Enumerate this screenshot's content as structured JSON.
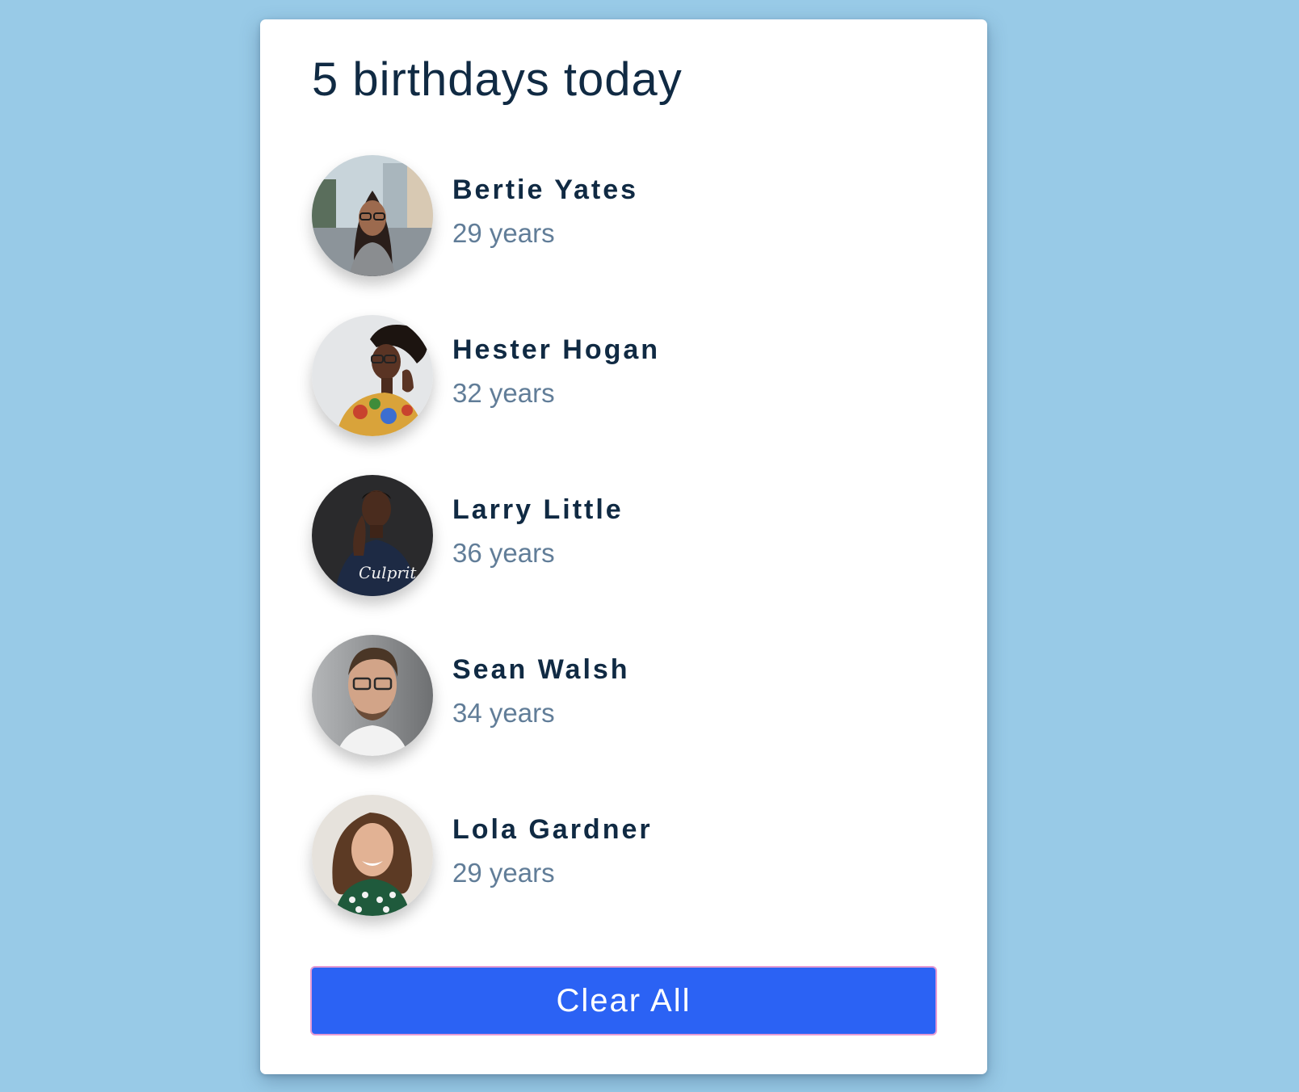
{
  "title": "5 birthdays today",
  "people": [
    {
      "name": "Bertie Yates",
      "age": "29 years",
      "avatar_icon": "woman-glasses-city-photo"
    },
    {
      "name": "Hester Hogan",
      "age": "32 years",
      "avatar_icon": "woman-glasses-floral-photo"
    },
    {
      "name": "Larry Little",
      "age": "36 years",
      "avatar_icon": "man-tshirt-dark-photo"
    },
    {
      "name": "Sean Walsh",
      "age": "34 years",
      "avatar_icon": "man-glasses-beard-photo"
    },
    {
      "name": "Lola Gardner",
      "age": "29 years",
      "avatar_icon": "woman-curly-hair-photo"
    }
  ],
  "button": {
    "label": "Clear All"
  },
  "colors": {
    "background": "#98cae7",
    "card": "#ffffff",
    "heading": "#102a43",
    "subtext": "#617d98",
    "button": "#2b62f4",
    "button_border": "#e59bd3"
  }
}
